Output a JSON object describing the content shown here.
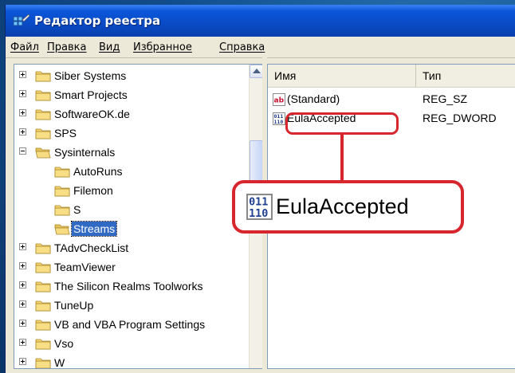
{
  "window": {
    "title": "Редактор реестра"
  },
  "menubar": {
    "items": [
      "Файл",
      "Правка",
      "Вид",
      "Избранное",
      "Справка"
    ]
  },
  "tree": {
    "items": [
      {
        "label": "Siber Systems",
        "expander": "plus"
      },
      {
        "label": "Smart Projects",
        "expander": "plus"
      },
      {
        "label": "SoftwareOK.de",
        "expander": "plus"
      },
      {
        "label": "SPS",
        "expander": "plus"
      },
      {
        "label": "Sysinternals",
        "expander": "minus"
      },
      {
        "label": "AutoRuns",
        "expander": "none"
      },
      {
        "label": "Filemon",
        "expander": "none"
      },
      {
        "label": "S",
        "expander": "none"
      },
      {
        "label": "Streams",
        "expander": "none",
        "selected": true
      },
      {
        "label": "TAdvCheckList",
        "expander": "plus"
      },
      {
        "label": "TeamViewer",
        "expander": "plus"
      },
      {
        "label": "The Silicon Realms Toolworks",
        "expander": "plus"
      },
      {
        "label": "TuneUp",
        "expander": "plus"
      },
      {
        "label": "VB and VBA Program Settings",
        "expander": "plus"
      },
      {
        "label": "Vso",
        "expander": "plus"
      },
      {
        "label": "W",
        "expander": "plus"
      }
    ]
  },
  "list": {
    "columns": {
      "name": "Имя",
      "type": "Тип"
    },
    "rows": [
      {
        "name": "(Standard)",
        "type": "REG_SZ",
        "icon": "string-value-icon"
      },
      {
        "name": "EulaAccepted",
        "type": "REG_DWORD",
        "icon": "binary-value-icon"
      }
    ]
  },
  "callout": {
    "label": "EulaAccepted",
    "icon": "binary-value-icon"
  },
  "colors": {
    "highlight": "#d7262e",
    "selection": "#316ac5",
    "titlebar": "#0a4bc6"
  }
}
